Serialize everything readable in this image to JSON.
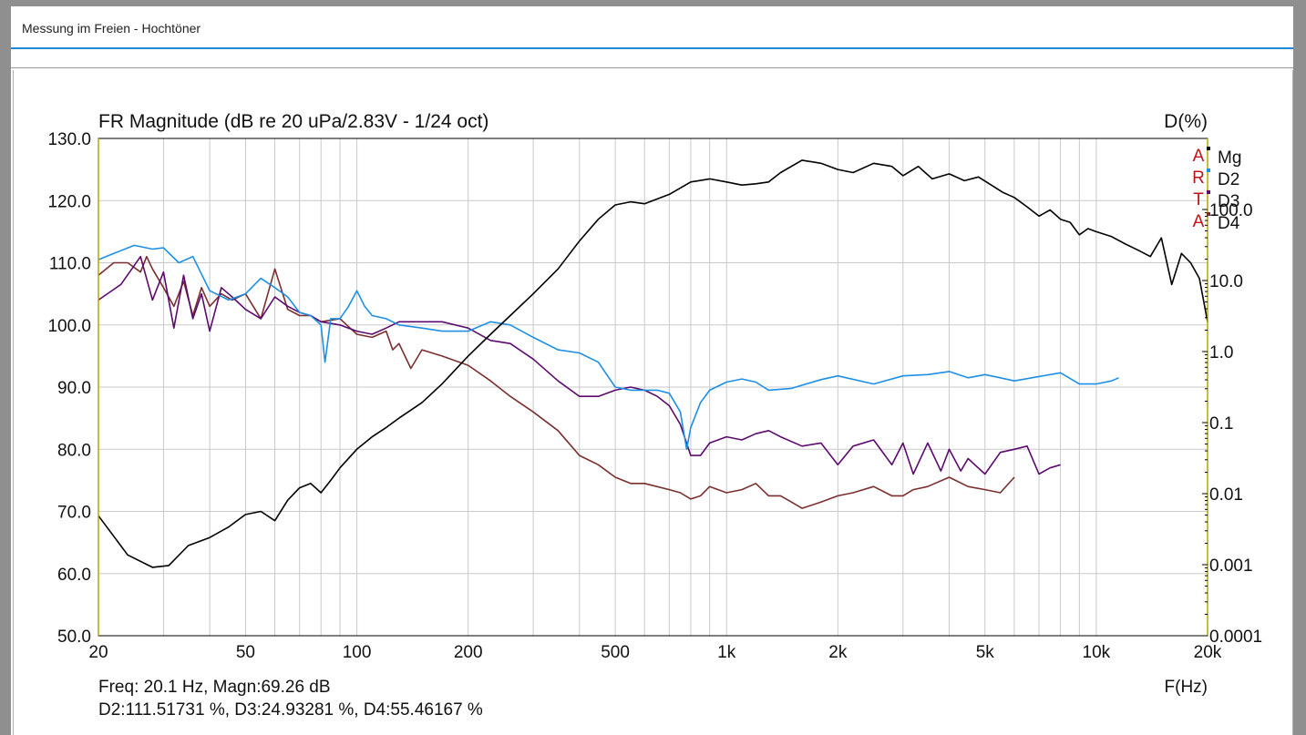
{
  "window": {
    "title": "Messung im Freien - Hochtöner"
  },
  "chart_data": {
    "type": "line",
    "title": "FR Magnitude (dB re 20 uPa/2.83V - 1/24 oct)",
    "right_axis_title": "D(%)",
    "xlabel": "F(Hz)",
    "xscale": "log",
    "xlim": [
      20,
      20000
    ],
    "x_ticks": [
      20,
      50,
      100,
      200,
      500,
      1000,
      2000,
      5000,
      10000,
      20000
    ],
    "x_tick_labels": [
      "20",
      "50",
      "100",
      "200",
      "500",
      "1k",
      "2k",
      "5k",
      "10k",
      "20k"
    ],
    "ylim": [
      50,
      130
    ],
    "y_ticks": [
      50,
      60,
      70,
      80,
      90,
      100,
      110,
      120,
      130
    ],
    "y_tick_labels": [
      "50.0",
      "60.0",
      "70.0",
      "80.0",
      "90.0",
      "100.0",
      "110.0",
      "120.0",
      "130.0"
    ],
    "right_scale": "log",
    "right_lim": [
      0.0001,
      1000
    ],
    "right_ticks": [
      0.0001,
      0.001,
      0.01,
      0.1,
      1,
      10,
      100
    ],
    "right_tick_labels": [
      "0.0001",
      "0.001",
      "0.01",
      "0.1",
      "1.0",
      "10.0",
      "100.0"
    ],
    "grid": true,
    "legend_position": "top-right",
    "arta_letters": [
      "A",
      "R",
      "T",
      "A"
    ],
    "series": [
      {
        "name": "Mg",
        "axis": "left",
        "color": "#000000",
        "x": [
          20,
          24,
          28,
          31,
          35,
          40,
          45,
          50,
          55,
          60,
          65,
          70,
          75,
          80,
          85,
          90,
          100,
          110,
          120,
          130,
          150,
          170,
          200,
          230,
          260,
          300,
          350,
          400,
          450,
          500,
          550,
          600,
          700,
          800,
          900,
          1000,
          1100,
          1200,
          1300,
          1400,
          1600,
          1800,
          2000,
          2200,
          2500,
          2800,
          3000,
          3300,
          3600,
          4000,
          4400,
          4800,
          5200,
          5600,
          6000,
          6500,
          7000,
          7500,
          8000,
          8500,
          9000,
          9500,
          10000,
          11000,
          12000,
          13000,
          14000,
          15000,
          16000,
          17000,
          18000,
          19000,
          20000
        ],
        "y": [
          69.3,
          63,
          61,
          61.3,
          64.5,
          65.8,
          67.5,
          69.5,
          70,
          68.5,
          71.8,
          73.8,
          74.5,
          73,
          75,
          77,
          80,
          82,
          83.5,
          85,
          87.5,
          90.5,
          95,
          98.5,
          101.5,
          105,
          109,
          113.5,
          117,
          119.3,
          119.8,
          119.5,
          121,
          123,
          123.5,
          123,
          122.5,
          122.7,
          123,
          124.5,
          126.5,
          126,
          125,
          124.5,
          126,
          125.5,
          124,
          125.5,
          123.5,
          124.3,
          123.2,
          123.8,
          122.5,
          121.3,
          120.5,
          119,
          117.5,
          118.5,
          117,
          116.5,
          114.5,
          115.5,
          115,
          114.2,
          113,
          112,
          111,
          114,
          106.5,
          111.5,
          110,
          107.5,
          100.5
        ]
      },
      {
        "name": "D2",
        "axis": "right",
        "color": "#1e8fe6",
        "x": [
          20,
          22,
          25,
          28,
          30,
          33,
          36,
          40,
          45,
          50,
          55,
          60,
          65,
          70,
          75,
          80,
          82,
          85,
          90,
          95,
          100,
          105,
          110,
          120,
          130,
          150,
          170,
          200,
          230,
          260,
          300,
          350,
          400,
          450,
          500,
          550,
          600,
          650,
          700,
          750,
          780,
          800,
          850,
          900,
          1000,
          1100,
          1200,
          1300,
          1500,
          1800,
          2000,
          2500,
          3000,
          3500,
          4000,
          4500,
          5000,
          5500,
          6000,
          7000,
          8000,
          9000,
          10000,
          11000,
          11500
        ],
        "y": [
          110.5,
          111.5,
          112.8,
          112.2,
          112.4,
          110,
          111,
          105.5,
          104,
          105,
          107.5,
          106,
          104.5,
          102,
          101.5,
          100,
          94,
          101,
          101,
          103,
          105.5,
          103,
          101.5,
          101,
          100,
          99.5,
          99,
          99,
          100.5,
          100,
          98,
          96,
          95.5,
          94,
          90,
          89.5,
          89.5,
          89.5,
          89,
          86,
          80,
          83.5,
          87.5,
          89.5,
          90.8,
          91.3,
          90.8,
          89.5,
          89.8,
          91.2,
          91.8,
          90.5,
          91.8,
          92,
          92.5,
          91.5,
          92,
          91.5,
          91,
          91.7,
          92.3,
          90.5,
          90.5,
          91,
          91.5
        ]
      },
      {
        "name": "D3",
        "axis": "right",
        "color": "#5c0a6e",
        "x": [
          20,
          23,
          26,
          28,
          30,
          32,
          34,
          36,
          38,
          40,
          43,
          46,
          50,
          55,
          60,
          65,
          70,
          75,
          80,
          90,
          100,
          110,
          120,
          130,
          140,
          150,
          170,
          200,
          230,
          260,
          300,
          350,
          400,
          450,
          500,
          550,
          600,
          650,
          700,
          750,
          800,
          850,
          900,
          1000,
          1100,
          1200,
          1300,
          1400,
          1600,
          1800,
          2000,
          2200,
          2500,
          2800,
          3000,
          3200,
          3500,
          3800,
          4000,
          4300,
          4500,
          5000,
          5500,
          6000,
          6500,
          7000,
          7500,
          8000
        ],
        "y": [
          104,
          106.5,
          111,
          104,
          108.5,
          99.5,
          108,
          101,
          105,
          99,
          106,
          104.5,
          102.5,
          101,
          104.5,
          103,
          102,
          101.5,
          100.5,
          100,
          99,
          98.5,
          99.5,
          100.5,
          100.5,
          100.5,
          100.5,
          99.5,
          97.5,
          97,
          94.5,
          91,
          88.5,
          88.5,
          89.5,
          90,
          89.5,
          88.5,
          87,
          84,
          79,
          79,
          81,
          82,
          81.5,
          82.5,
          83,
          82,
          80.5,
          81,
          77.5,
          80.5,
          81.5,
          77.5,
          81,
          76,
          81,
          76.5,
          80,
          76.5,
          78.5,
          76,
          79.5,
          80,
          80.5,
          76,
          77,
          77.5
        ]
      },
      {
        "name": "D4",
        "axis": "right",
        "color": "#7a2e2e",
        "x": [
          20,
          22,
          24,
          26,
          27,
          28,
          30,
          32,
          34,
          36,
          38,
          40,
          43,
          46,
          50,
          55,
          60,
          65,
          70,
          75,
          80,
          90,
          100,
          110,
          120,
          125,
          130,
          140,
          150,
          170,
          200,
          230,
          260,
          300,
          350,
          400,
          450,
          500,
          550,
          600,
          700,
          750,
          800,
          850,
          900,
          1000,
          1100,
          1200,
          1300,
          1400,
          1500,
          1600,
          1800,
          2000,
          2200,
          2500,
          2800,
          3000,
          3200,
          3500,
          4000,
          4500,
          5000,
          5500,
          6000
        ],
        "y": [
          108,
          110,
          110,
          108.5,
          111,
          109,
          106,
          103,
          107,
          101.5,
          106,
          103,
          105,
          104,
          105,
          101,
          109,
          102.5,
          101.5,
          101.5,
          100.5,
          101,
          98.5,
          98,
          99,
          96,
          97,
          93,
          96,
          95,
          93.5,
          91,
          88.5,
          86,
          83,
          79,
          77.5,
          75.5,
          74.5,
          74.5,
          73.5,
          73,
          72,
          72.5,
          74,
          73,
          73.5,
          74.5,
          72.5,
          72.5,
          71.5,
          70.5,
          71.5,
          72.5,
          73,
          74,
          72.5,
          72.5,
          73.5,
          74,
          75.5,
          74,
          73.5,
          73,
          75.5
        ]
      }
    ]
  },
  "readout": {
    "line1": "Freq: 20.1 Hz, Magn:69.26 dB",
    "line2": "D2:111.51731 %, D3:24.93281 %, D4:55.46167 %"
  }
}
